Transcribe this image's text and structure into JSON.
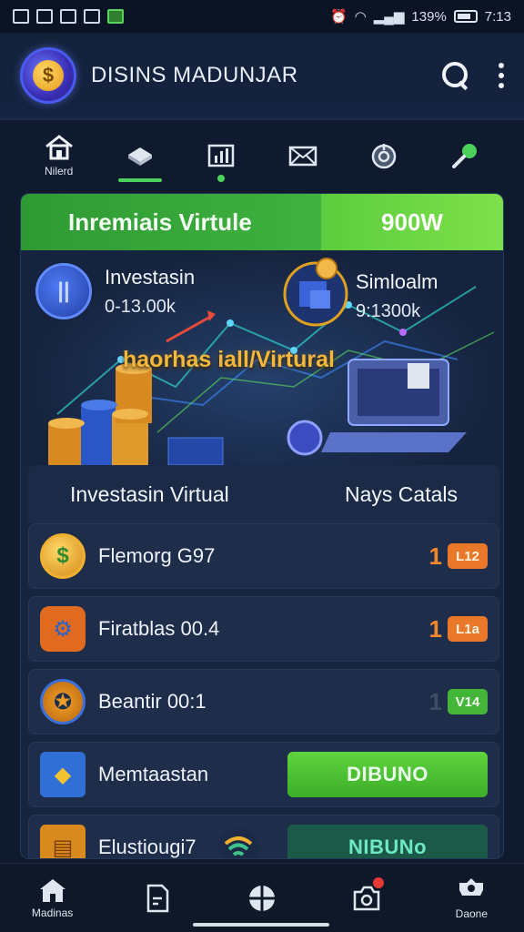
{
  "status_bar": {
    "right_text": "139%",
    "time": "7:13"
  },
  "app_bar": {
    "title": "DISINS MADUNJAR",
    "logo_symbol": "$",
    "icons": [
      "search-icon",
      "more-vert-icon"
    ]
  },
  "tabs": [
    {
      "label": "Nilerd",
      "icon": "home-icon"
    },
    {
      "label": "",
      "icon": "diamond-icon"
    },
    {
      "label": "",
      "icon": "chart-icon"
    },
    {
      "label": "",
      "icon": "mail-icon"
    },
    {
      "label": "",
      "icon": "target-icon"
    },
    {
      "label": "",
      "icon": "pin-icon"
    }
  ],
  "banner": {
    "title": "Inremiais Virtule",
    "amount": "900W"
  },
  "hero": {
    "left_name": "Investasin",
    "left_value": "0-13.00k",
    "right_name": "Simloalm",
    "right_value": "9:1300k",
    "caption": "haorhas iall/Virtural",
    "left_badge": "||",
    "right_badge": "$"
  },
  "list": {
    "header_left": "Investasin Virtual",
    "header_right": "Nays Catals",
    "rows": [
      {
        "label": "Flemorg G97",
        "num": "1",
        "badge": "L12",
        "icon": "dollar-coin-icon",
        "symbol": "$",
        "accent": "#f28a2a",
        "badge_bg": "#e9782a",
        "icon_bg": "#e0a324"
      },
      {
        "label": "Firatblas 00.4",
        "num": "1",
        "badge": "L1a",
        "icon": "gear-icon",
        "symbol": "⚙",
        "accent": "#f28a2a",
        "badge_bg": "#e9782a",
        "icon_bg": "#e06a20"
      },
      {
        "label": "Beantir 00:1",
        "num": "1",
        "badge": "V14",
        "icon": "shield-coin-icon",
        "symbol": "✪",
        "accent": "#3f4e66",
        "badge_bg": "#45b53a",
        "icon_bg": "#d9901e"
      },
      {
        "label": "Memtaastan",
        "button": "DIBUNO",
        "icon": "tag-icon",
        "symbol": "◆",
        "btn_bg": "#4bc234",
        "btn_fg": "#eaffea",
        "icon_bg": "#2f6fd6"
      },
      {
        "label": "Elustiougi7",
        "button": "NIBUNo",
        "icon": "chest-icon",
        "symbol": "▤",
        "btn_bg": "#1a5a46",
        "btn_fg": "#6ee8c4",
        "icon_bg": "#d98a1c"
      }
    ]
  },
  "bottom_nav": [
    {
      "label": "Madinas",
      "icon": "home-icon"
    },
    {
      "label": "",
      "icon": "document-icon"
    },
    {
      "label": "",
      "icon": "globe-icon"
    },
    {
      "label": "",
      "icon": "camera-icon"
    },
    {
      "label": "Daone",
      "icon": "gear-icon"
    }
  ]
}
